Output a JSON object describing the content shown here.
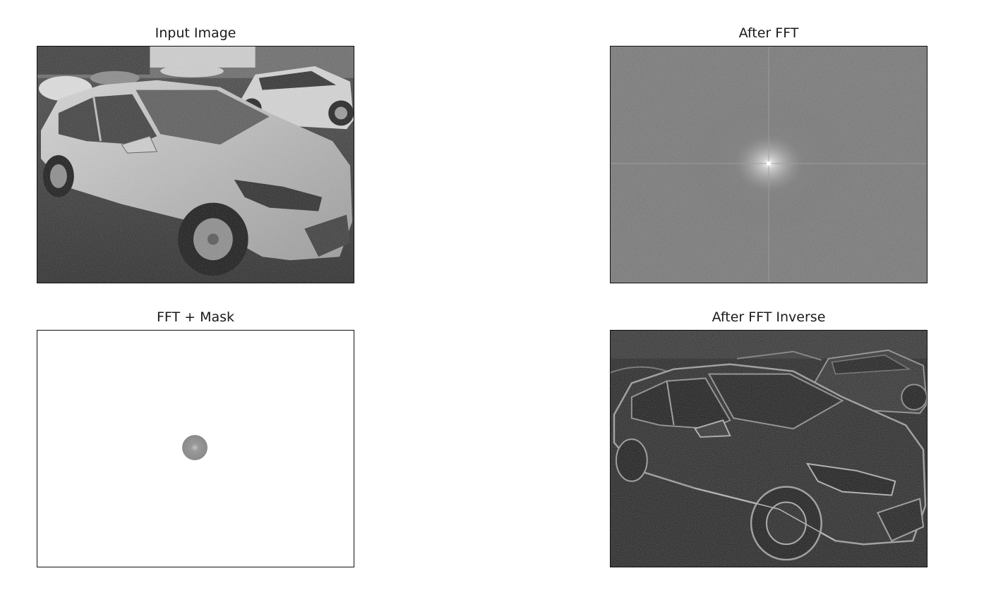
{
  "figure": {
    "panels": [
      {
        "id": "input",
        "title": "Input Image",
        "image": "grayscale-car-photo"
      },
      {
        "id": "fft",
        "title": "After FFT",
        "image": "fft-magnitude-spectrum"
      },
      {
        "id": "mask",
        "title": "FFT + Mask",
        "image": "masked-spectrum-center-disc"
      },
      {
        "id": "inverse",
        "title": "After FFT Inverse",
        "image": "high-pass-edge-image"
      }
    ]
  },
  "colors": {
    "axes_border": "#111111",
    "background": "#ffffff",
    "spectrum_gray": "#6e6e6e",
    "inverse_dark": "#1c1c1c"
  }
}
